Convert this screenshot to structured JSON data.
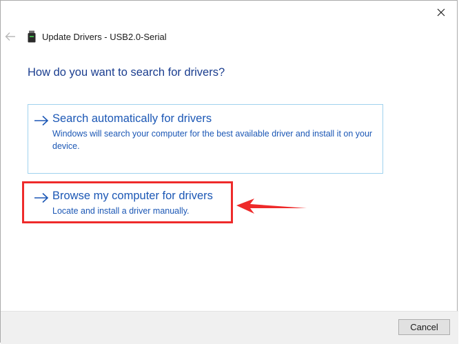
{
  "window": {
    "title": "Update Drivers - USB2.0-Serial",
    "close_icon": "close-icon",
    "back_icon": "back-arrow-icon",
    "device_icon": "usb-device-icon"
  },
  "heading": "How do you want to search for drivers?",
  "options": [
    {
      "title": "Search automatically for drivers",
      "description": "Windows will search your computer for the best available driver and install it on your device.",
      "icon": "arrow-right-icon"
    },
    {
      "title": "Browse my computer for drivers",
      "description": "Locate and install a driver manually.",
      "icon": "arrow-right-icon",
      "highlighted": true
    }
  ],
  "annotation": {
    "icon": "red-pointer-arrow",
    "color": "#ee2a2a"
  },
  "footer": {
    "cancel_label": "Cancel"
  },
  "colors": {
    "link_blue": "#1b57b5",
    "heading_blue": "#1a3d8f",
    "highlight_red": "#ee2a2a"
  }
}
